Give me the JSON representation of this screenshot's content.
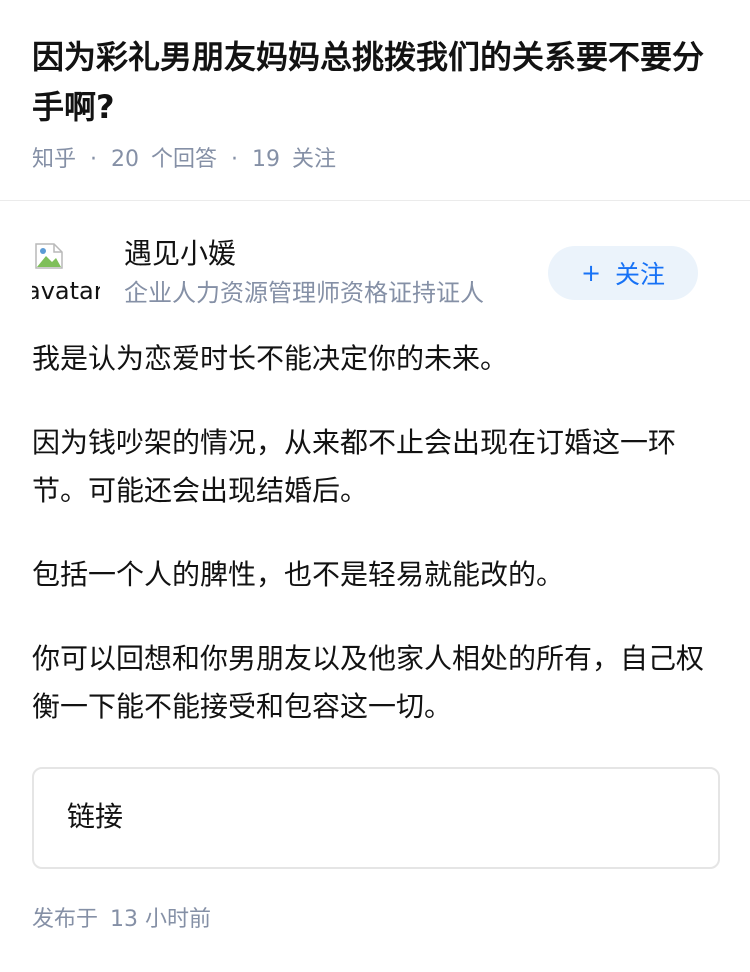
{
  "question": {
    "title": "因为彩礼男朋友妈妈总挑拨我们的关系要不要分手啊?",
    "site": "知乎",
    "answer_count": "20",
    "answer_unit": "个回答",
    "follower_count": "19",
    "follower_unit": "关注",
    "separator": "·"
  },
  "answer": {
    "author": {
      "avatar_alt": "avatar",
      "name": "遇见小媛",
      "bio": "企业人力资源管理师资格证持证人",
      "follow_label": "关注",
      "follow_icon": "plus-icon"
    },
    "paragraphs": [
      "我是认为恋爱时长不能决定你的未来。",
      "因为钱吵架的情况，从来都不止会出现在订婚这一环节。可能还会出现结婚后。",
      "包括一个人的脾性，也不是轻易就能改的。",
      "你可以回想和你男朋友以及他家人相处的所有，自己权衡一下能不能接受和包容这一切。"
    ],
    "link_label": "链接",
    "published_label": "发布于",
    "published_time": "13 小时前"
  },
  "colors": {
    "accent": "#1772f6",
    "meta": "#8590a6",
    "text": "#121212",
    "follow_bg": "#ebf3fb"
  }
}
